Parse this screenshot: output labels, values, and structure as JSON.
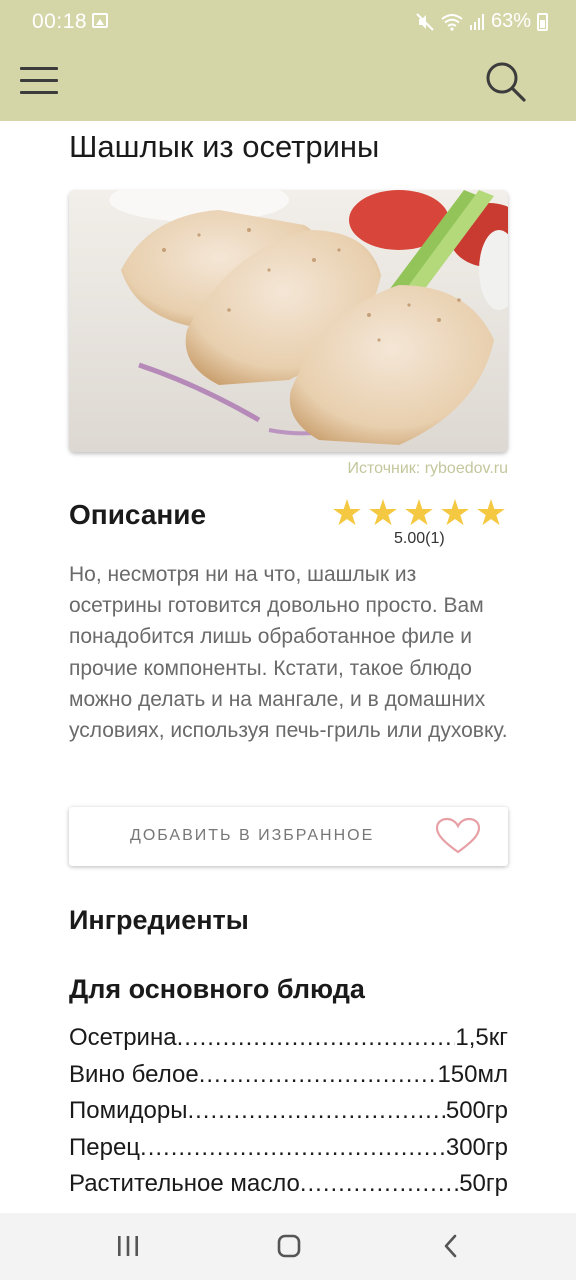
{
  "status_bar": {
    "time": "00:18",
    "battery": "63%",
    "icons": [
      "image-icon",
      "mute-icon",
      "wifi-icon",
      "signal-icon",
      "battery-icon"
    ]
  },
  "toolbar": {
    "menu_icon": "menu-icon",
    "search_icon": "search-icon",
    "background": "#d5d6a8"
  },
  "recipe": {
    "title": "Шашлык из осетрины",
    "source": "Источник: ryboedov.ru",
    "description_heading": "Описание",
    "rating": {
      "value": 5,
      "max": 5,
      "text": "5.00(1)"
    },
    "description": "Но, несмотря ни на что, шашлык из осетрины готовится довольно просто. Вам понадобится лишь обработанное филе и прочие компоненты. Кстати, такое блюдо можно делать и на мангале, и в домашних условиях, используя печь-гриль или духовку.",
    "favorite_label": "ДОБАВИТЬ В ИЗБРАННОЕ",
    "ingredients_heading": "Ингредиенты",
    "group_heading": "Для основного блюда",
    "ingredients": [
      {
        "name": "Осетрина",
        "qty": "1,5кг"
      },
      {
        "name": "Вино белое",
        "qty": "150мл"
      },
      {
        "name": "Помидоры",
        "qty": "500гр"
      },
      {
        "name": "Перец",
        "qty": "300гр"
      },
      {
        "name": "Растительное масло",
        "qty": "50гр"
      }
    ]
  },
  "nav_bar": {
    "buttons": [
      "recents-icon",
      "home-icon",
      "back-icon"
    ]
  }
}
